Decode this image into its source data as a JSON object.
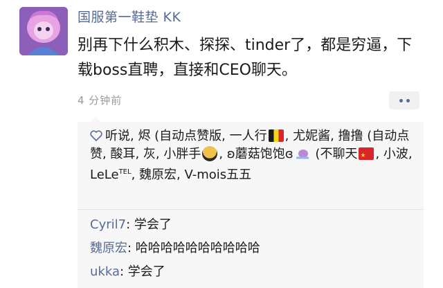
{
  "post": {
    "nickname": "国服第一鞋垫 KK",
    "content": "别再下什么积木、探探、tinder了，都是穷逼，下载boss直聘，直接和CEO聊天。",
    "time": "4 分钟前"
  },
  "likes": {
    "text_1": "听说, 烬 (自动点赞版, 一人行",
    "text_2": ", 尤妮酱, 撸撸 (自动点赞, 酸耳, 灰, 小胖手",
    "text_3": ", ʚ蘑菇饱饱ɞ",
    "text_4": " (不聊天",
    "text_5": ", 小波, LeLe",
    "tel_mark": "TEL",
    "text_6": ", 魏原宏, V-mois五五"
  },
  "comments": [
    {
      "author": "Cyril7",
      "text": "学会了"
    },
    {
      "author": "魏原宏",
      "text": "哈哈哈哈哈哈哈哈哈哈"
    },
    {
      "author": "ukka",
      "text": "学会了"
    }
  ]
}
